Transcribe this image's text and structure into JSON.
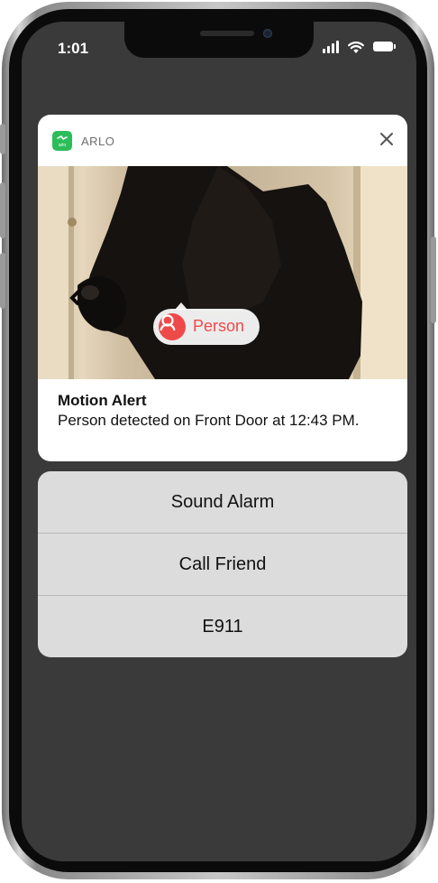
{
  "status_bar": {
    "time": "1:01"
  },
  "notification": {
    "app_name": "ARLO",
    "app_icon_label": "arlo",
    "detection_label": "Person",
    "title": "Motion Alert",
    "body": "Person detected on Front Door at 12:43 PM."
  },
  "actions": [
    {
      "label": "Sound Alarm"
    },
    {
      "label": "Call Friend"
    },
    {
      "label": "E911"
    }
  ],
  "colors": {
    "app_icon": "#2bbd5a",
    "person_accent": "#ef4a4a",
    "action_background": "#dcdcdc"
  }
}
